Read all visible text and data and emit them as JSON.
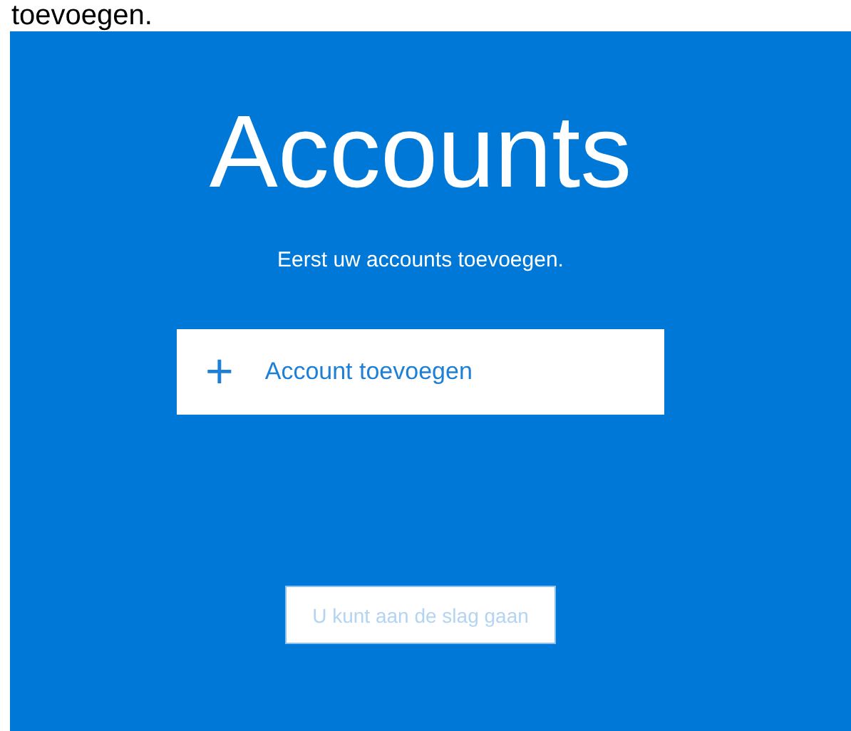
{
  "caption": "toevoegen.",
  "panel": {
    "title": "Accounts",
    "subtitle": "Eerst uw accounts toevoegen.",
    "add_button": {
      "icon": "+",
      "label": "Account toevoegen"
    },
    "start_button": {
      "label": "U kunt aan de slag gaan",
      "disabled": true
    }
  }
}
